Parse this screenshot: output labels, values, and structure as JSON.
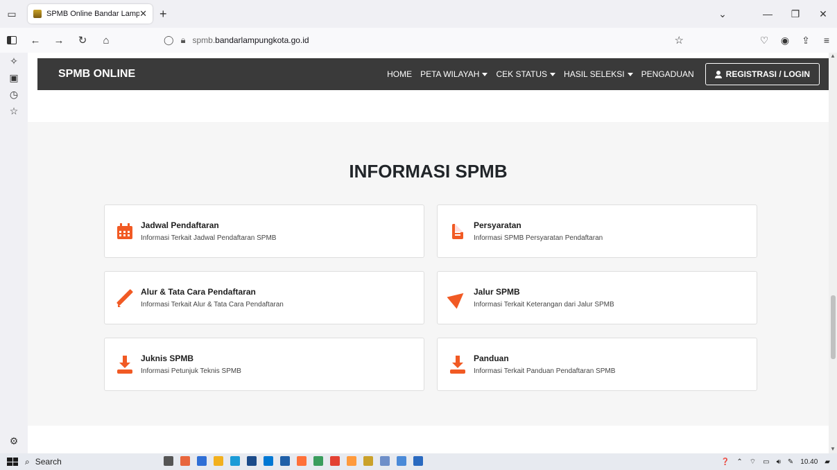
{
  "browser": {
    "tab_title": "SPMB Online Bandar Lampung",
    "tab_close": "✕",
    "new_tab": "+",
    "url_host_prefix": "spmb.",
    "url_domain": "bandarlampungkota.go.id",
    "search_placeholder": "Search",
    "clock": "10.40"
  },
  "site": {
    "brand": "SPMB ONLINE",
    "menu": {
      "home": "HOME",
      "peta": "PETA WILAYAH",
      "cek": "CEK STATUS",
      "hasil": "HASIL SELEKSI",
      "pengaduan": "PENGADUAN",
      "login": "REGISTRASI / LOGIN"
    }
  },
  "info": {
    "title": "INFORMASI SPMB",
    "cards": [
      {
        "title": "Jadwal Pendaftaran",
        "desc": "Informasi Terkait Jadwal Pendaftaran SPMB",
        "icon": "calendar-icon"
      },
      {
        "title": "Persyaratan",
        "desc": "Informasi SPMB Persyaratan Pendaftaran",
        "icon": "file-icon"
      },
      {
        "title": "Alur & Tata Cara Pendaftaran",
        "desc": "Informasi Terkait Alur & Tata Cara Pendaftaran",
        "icon": "pencil-icon"
      },
      {
        "title": "Jalur SPMB",
        "desc": "Informasi Terkait Keterangan dari Jalur SPMB",
        "icon": "paper-plane-icon"
      },
      {
        "title": "Juknis SPMB",
        "desc": "Informasi Petunjuk Teknis SPMB",
        "icon": "download-icon"
      },
      {
        "title": "Panduan",
        "desc": "Informasi Terkait Panduan Pendaftaran SPMB",
        "icon": "download-icon"
      }
    ]
  },
  "colors": {
    "accent": "#f15a24",
    "header_bg": "#3a3a3a"
  }
}
